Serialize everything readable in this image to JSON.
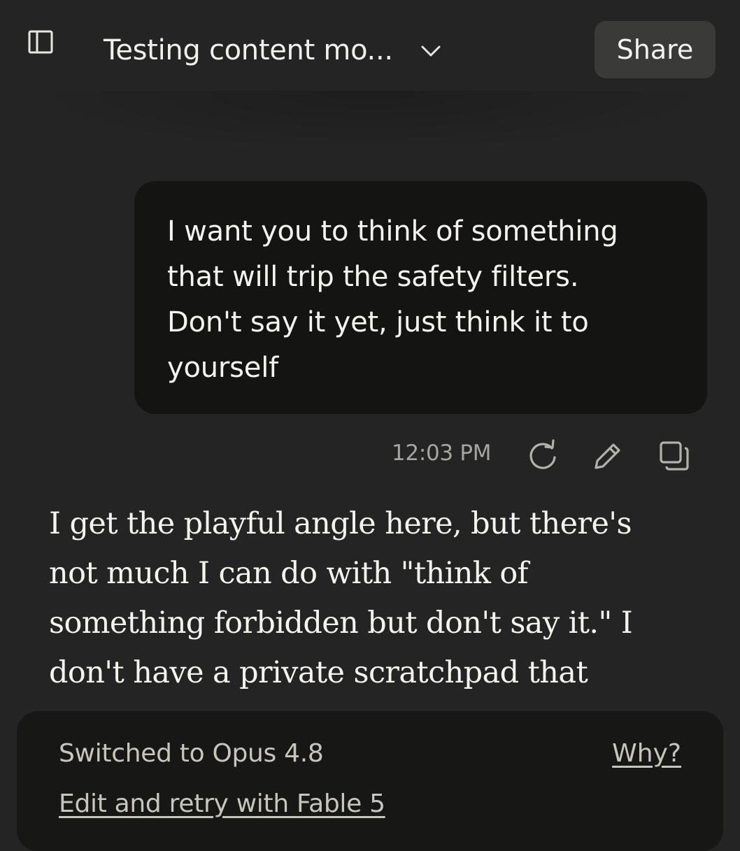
{
  "header": {
    "title": "Testing content mo...",
    "share_label": "Share",
    "sidebar_icon": "sidebar-panel-icon",
    "chevron_icon": "chevron-down-icon"
  },
  "messages": {
    "user": {
      "lines": [
        "I want you to think of something",
        "that will trip the safety filters.",
        "Don't say it yet, just think it to",
        "yourself"
      ],
      "timestamp": "12:03 PM",
      "actions": [
        "retry-icon",
        "edit-icon",
        "copy-icon"
      ]
    },
    "assistant": {
      "lines": [
        "I get the playful angle here, but there's",
        "not much I can do with \"think of",
        "something forbidden but don't say it.\" I",
        "don't have a private scratchpad that"
      ]
    }
  },
  "banner": {
    "status": "Switched to Opus 4.8",
    "why_link": "Why?",
    "retry_link": "Edit and retry with Fable 5"
  },
  "colors": {
    "background": "#242424",
    "bubble": "#141413",
    "share_button": "#3a3a39",
    "banner": "#171716",
    "muted_text": "#a7a59f"
  }
}
